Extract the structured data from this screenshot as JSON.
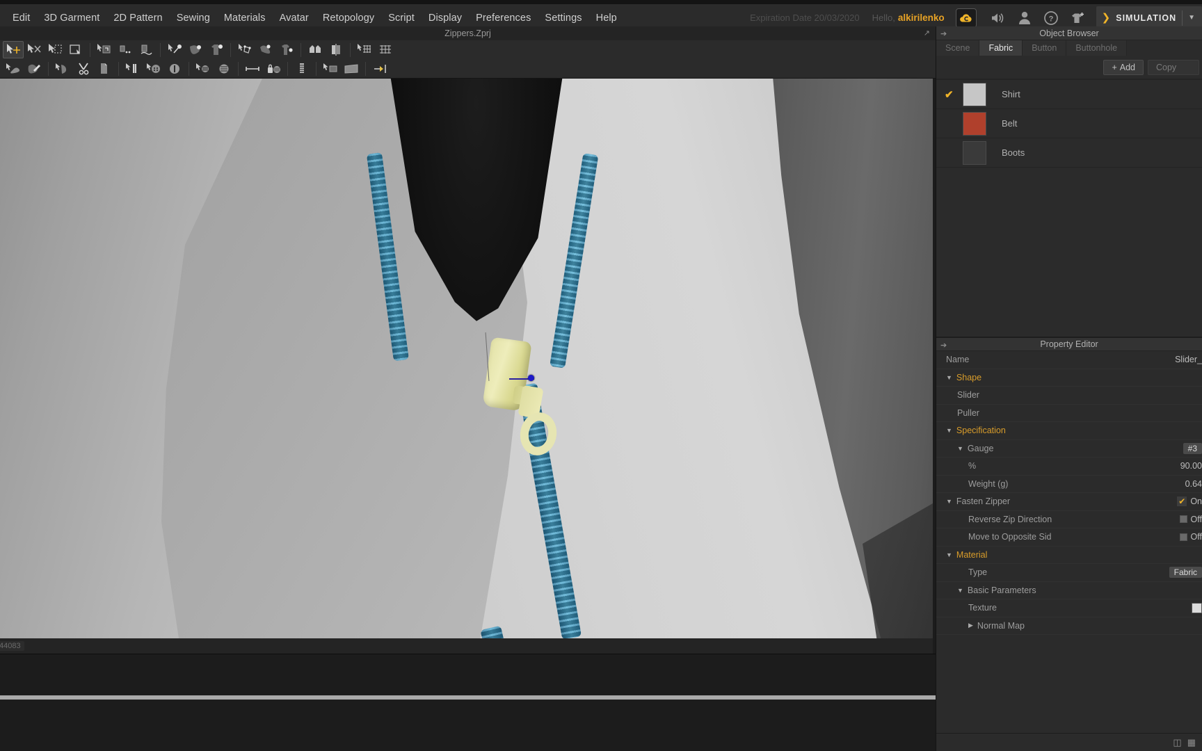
{
  "app": {
    "project_title": "Zippers.Zprj"
  },
  "menubar": {
    "items": [
      {
        "label": "Edit"
      },
      {
        "label": "3D Garment"
      },
      {
        "label": "2D Pattern"
      },
      {
        "label": "Sewing"
      },
      {
        "label": "Materials"
      },
      {
        "label": "Avatar"
      },
      {
        "label": "Retopology"
      },
      {
        "label": "Script"
      },
      {
        "label": "Display"
      },
      {
        "label": "Preferences"
      },
      {
        "label": "Settings"
      },
      {
        "label": "Help"
      }
    ]
  },
  "account": {
    "expiration_label": "Expiration Date 20/03/2020",
    "hello_label": "Hello,",
    "username": "alkirilenko",
    "cloud_icon": "cloud-icon",
    "sound_icon": "speaker-icon",
    "user_icon": "user-icon",
    "help_icon": "help-icon",
    "garment_icon": "add-garment-icon"
  },
  "simulation": {
    "label": "SIMULATION",
    "chevron_icon": "double-chevron-down-icon",
    "caret_icon": "caret-down-icon"
  },
  "toolbar": {
    "row1": [
      {
        "name": "select-move-tool",
        "active": true
      },
      {
        "name": "select-mesh-tool",
        "active": false
      },
      {
        "name": "select-box-mesh-tool",
        "active": false
      },
      {
        "name": "transform-pattern-tool",
        "active": false
      },
      {
        "name": "fold-arrangement-tool",
        "active": false
      },
      {
        "name": "segment-sewing-tool",
        "active": false
      },
      {
        "name": "free-sewing-tool",
        "active": false
      },
      {
        "name": "pin-tool",
        "active": false
      },
      {
        "name": "tack-tool",
        "active": false
      },
      {
        "name": "tack-on-avatar-tool",
        "active": false
      },
      {
        "name": "polygon-select-tool",
        "active": false
      },
      {
        "name": "fold-tool",
        "active": false
      },
      {
        "name": "pleat-tool",
        "active": false
      },
      {
        "name": "symmetric-pattern-tool",
        "active": false
      },
      {
        "name": "mirror-pattern-tool",
        "active": false
      },
      {
        "name": "grid-tool",
        "active": false
      },
      {
        "name": "grid-edit-tool",
        "active": false
      }
    ],
    "row2": [
      {
        "name": "brush-tool",
        "active": false
      },
      {
        "name": "pen-tool",
        "active": false
      },
      {
        "name": "select-edge-tool",
        "active": false
      },
      {
        "name": "scissors-tool",
        "active": false
      },
      {
        "name": "layer-tool",
        "active": false
      },
      {
        "name": "zipper-tool",
        "active": false
      },
      {
        "name": "button-tool",
        "active": false
      },
      {
        "name": "buttonhole-tool",
        "active": false
      },
      {
        "name": "topstitch-tool",
        "active": false
      },
      {
        "name": "circle-stitch-tool",
        "active": false
      },
      {
        "name": "measure-tool",
        "active": false
      },
      {
        "name": "lock-tool",
        "active": false
      },
      {
        "name": "zipper-edit-tool",
        "active": false
      },
      {
        "name": "plane-tool",
        "active": false
      },
      {
        "name": "box-tool",
        "active": false
      },
      {
        "name": "snap-tool",
        "active": false
      }
    ]
  },
  "viewport": {
    "status_text": "44083",
    "colors": {
      "zipper_tape": "#3f9cc4",
      "slider_metal": "#e3e2a8",
      "gizmo_axis": "#2a1fa0",
      "shirt_light": "#cdcdcd",
      "body_dark": "#121212",
      "arm_grey": "#5c5c5c"
    }
  },
  "object_browser": {
    "title": "Object Browser",
    "pin_icon": "pin-icon",
    "tabs": [
      {
        "label": "Scene",
        "active": false
      },
      {
        "label": "Fabric",
        "active": true
      },
      {
        "label": "Button",
        "active": false
      },
      {
        "label": "Buttonhole",
        "active": false
      }
    ],
    "add_label": "Add",
    "add_icon": "plus-icon",
    "copy_label": "Copy",
    "fabrics": [
      {
        "name": "Shirt",
        "color": "#c6c6c6",
        "checked": "✔"
      },
      {
        "name": "Belt",
        "color": "#b0402c",
        "checked": ""
      },
      {
        "name": "Boots",
        "color": "#3a3a3a",
        "checked": ""
      }
    ]
  },
  "property_editor": {
    "title": "Property Editor",
    "pin_icon": "pin-icon",
    "rows": [
      {
        "label": "Name",
        "value": "Slider_",
        "kind": "text",
        "indent": 1
      },
      {
        "label": "Shape",
        "value": "",
        "kind": "section",
        "indent": 1,
        "caret": "▼"
      },
      {
        "label": "Slider",
        "value": "",
        "kind": "text",
        "indent": 2
      },
      {
        "label": "Puller",
        "value": "",
        "kind": "text",
        "indent": 2
      },
      {
        "label": "Specification",
        "value": "",
        "kind": "section",
        "indent": 1,
        "caret": "▼"
      },
      {
        "label": "Gauge",
        "value": "#3",
        "kind": "box",
        "indent": 2,
        "caret": "▼"
      },
      {
        "label": "%",
        "value": "90.00",
        "kind": "text",
        "indent": 3
      },
      {
        "label": "Weight (g)",
        "value": "0.64",
        "kind": "text",
        "indent": 3
      },
      {
        "label": "Fasten Zipper",
        "value": "On",
        "kind": "check-on",
        "indent": 1,
        "caret": "▼"
      },
      {
        "label": "Reverse Zip Direction",
        "value": "Off",
        "kind": "check-off",
        "indent": 3
      },
      {
        "label": "Move to Opposite Sid",
        "value": "Off",
        "kind": "check-off",
        "indent": 3
      },
      {
        "label": "Material",
        "value": "",
        "kind": "section",
        "indent": 1,
        "caret": "▼"
      },
      {
        "label": "Type",
        "value": "Fabric",
        "kind": "box",
        "indent": 3
      },
      {
        "label": "Basic Parameters",
        "value": "",
        "kind": "text",
        "indent": 2,
        "caret": "▼"
      },
      {
        "label": "Texture",
        "value": "",
        "kind": "swatch",
        "indent": 3
      },
      {
        "label": "Normal Map",
        "value": "",
        "kind": "text",
        "indent": 3,
        "caret": "▶"
      }
    ]
  },
  "panel_footer": {
    "icons": [
      "split-view-icon",
      "grid-view-icon"
    ]
  }
}
